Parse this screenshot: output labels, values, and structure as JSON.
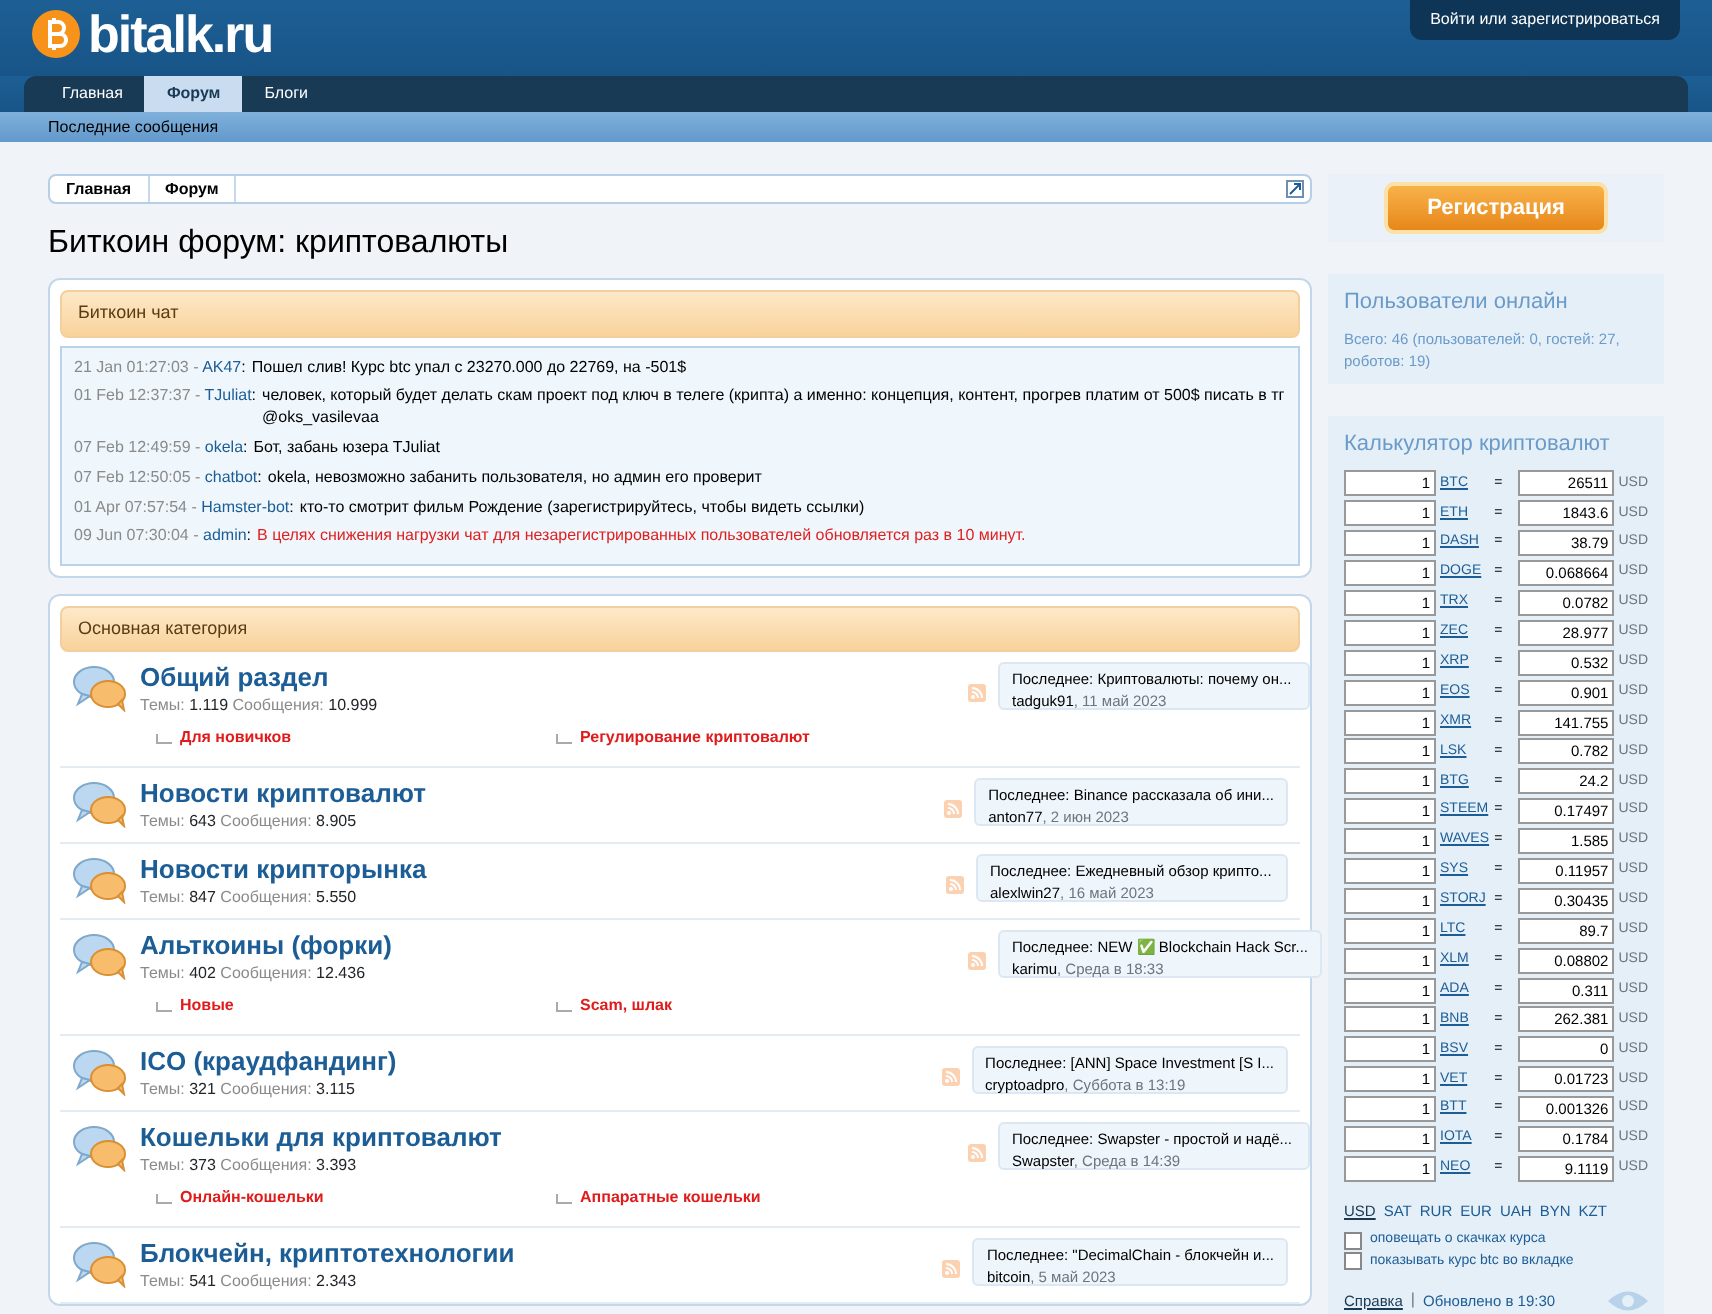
{
  "header": {
    "logo": "bitalk.ru",
    "login_link": "Войти или зарегистрироваться"
  },
  "tabs": [
    {
      "label": "Главная",
      "selected": false
    },
    {
      "label": "Форум",
      "selected": true
    },
    {
      "label": "Блоги",
      "selected": false
    }
  ],
  "subnav": [
    "Последние сообщения"
  ],
  "breadcrumbs": [
    "Главная",
    "Форум"
  ],
  "page_title": "Биткоин форум: криптовалюты",
  "chat": {
    "title": "Биткоин чат",
    "messages": [
      {
        "time": "21 Jan 01:27:03 -",
        "user": "AK47",
        "colon": ":",
        "text": "Пошел слив! Курс btc упал с 23270.000 до 22769, на -501$",
        "alert": false
      },
      {
        "time": "01 Feb 12:37:37 -",
        "user": "TJuliat",
        "colon": ":",
        "text": "человек, который будет делать скам проект под ключ в телеге (крипта) а именно: концепция, контент, прогрев платим от 500$ писать в тг @oks_vasilevaa",
        "alert": false
      },
      {
        "time": "07 Feb 12:49:59 -",
        "user": "okela",
        "colon": ":",
        "text": "Бот, забань юзера TJuliat",
        "alert": false
      },
      {
        "time": "07 Feb 12:50:05 -",
        "user": "chatbot",
        "colon": ":",
        "text": "okela, невозможно забанить пользователя, но админ его проверит",
        "alert": false
      },
      {
        "time": "01 Apr 07:57:54 -",
        "user": "Hamster-bot",
        "colon": ":",
        "text": "кто-то смотрит фильм Рождение (зарегистрируйтесь, чтобы видеть ссылки)",
        "alert": false
      },
      {
        "time": "09 Jun 07:30:04 -",
        "user": "admin",
        "colon": ":",
        "text": "В целях снижения нагрузки чат для незарегистрированных пользователей обновляется раз в 10 минут.",
        "alert": true
      }
    ]
  },
  "category": {
    "title": "Основная категория",
    "forums": [
      {
        "name": "Общий раздел",
        "themes_label": "Темы:",
        "themes": "1.119",
        "posts_label": "Сообщения:",
        "posts": "10.999",
        "subforums": [
          "Для новичков",
          "Регулирование криптовалют"
        ],
        "last_label": "Последнее:",
        "last_title": "Криптовалюты: почему он...",
        "last_user": "tadguk91",
        "last_date": ", 11 май 2023"
      },
      {
        "name": "Новости криптовалют",
        "themes_label": "Темы:",
        "themes": "643",
        "posts_label": "Сообщения:",
        "posts": "8.905",
        "last_label": "Последнее:",
        "last_title": "Binance рассказала об ини...",
        "last_user": "anton77",
        "last_date": ", 2 июн 2023"
      },
      {
        "name": "Новости крипторынка",
        "themes_label": "Темы:",
        "themes": "847",
        "posts_label": "Сообщения:",
        "posts": "5.550",
        "last_label": "Последнее:",
        "last_title": "Ежедневный обзор крипто...",
        "last_user": "alexlwin27",
        "last_date": ", 16 май 2023"
      },
      {
        "name": "Альткоины (форки)",
        "themes_label": "Темы:",
        "themes": "402",
        "posts_label": "Сообщения:",
        "posts": "12.436",
        "subforums": [
          "Новые",
          "Scam, шлак"
        ],
        "last_label": "Последнее:",
        "last_title": "NEW ✅ Blockchain Hack Scr...",
        "last_user": "karimu",
        "last_date": ", Среда в 18:33"
      },
      {
        "name": "ICO (краудфандинг)",
        "themes_label": "Темы:",
        "themes": "321",
        "posts_label": "Сообщения:",
        "posts": "3.115",
        "last_label": "Последнее:",
        "last_title": "[ANN] Space Investment [S I...",
        "last_user": "cryptoadpro",
        "last_date": ", Суббота в 13:19"
      },
      {
        "name": "Кошельки для криптовалют",
        "themes_label": "Темы:",
        "themes": "373",
        "posts_label": "Сообщения:",
        "posts": "3.393",
        "subforums": [
          "Онлайн-кошельки",
          "Аппаратные кошельки"
        ],
        "last_label": "Последнее:",
        "last_title": "Swapster - простой и надё...",
        "last_user": "Swapster",
        "last_date": ", Среда в 14:39"
      },
      {
        "name": "Блокчейн, криптотехнологии",
        "themes_label": "Темы:",
        "themes": "541",
        "posts_label": "Сообщения:",
        "posts": "2.343",
        "last_label": "Последнее:",
        "last_title": "\"DecimalChain - блокчейн и...",
        "last_user": "bitcoin",
        "last_date": ", 5 май 2023"
      }
    ]
  },
  "register_button": "Регистрация",
  "online": {
    "title": "Пользователи онлайн",
    "text": "Всего: 46 (пользователей: 0, гостей: 27, роботов: 19)"
  },
  "calculator": {
    "title": "Калькулятор криптовалют",
    "rows": [
      {
        "amount": "1",
        "coin": "BTC",
        "eq": "=",
        "value": "26511",
        "unit": "USD"
      },
      {
        "amount": "1",
        "coin": "ETH",
        "eq": "=",
        "value": "1843.6",
        "unit": "USD"
      },
      {
        "amount": "1",
        "coin": "DASH",
        "eq": "=",
        "value": "38.79",
        "unit": "USD"
      },
      {
        "amount": "1",
        "coin": "DOGE",
        "eq": "=",
        "value": "0.068664",
        "unit": "USD"
      },
      {
        "amount": "1",
        "coin": "TRX",
        "eq": "=",
        "value": "0.0782",
        "unit": "USD"
      },
      {
        "amount": "1",
        "coin": "ZEC",
        "eq": "=",
        "value": "28.977",
        "unit": "USD"
      },
      {
        "amount": "1",
        "coin": "XRP",
        "eq": "=",
        "value": "0.532",
        "unit": "USD"
      },
      {
        "amount": "1",
        "coin": "EOS",
        "eq": "=",
        "value": "0.901",
        "unit": "USD"
      },
      {
        "amount": "1",
        "coin": "XMR",
        "eq": "=",
        "value": "141.755",
        "unit": "USD"
      },
      {
        "amount": "1",
        "coin": "LSK",
        "eq": "=",
        "value": "0.782",
        "unit": "USD"
      },
      {
        "amount": "1",
        "coin": "BTG",
        "eq": "=",
        "value": "24.2",
        "unit": "USD"
      },
      {
        "amount": "1",
        "coin": "STEEM",
        "eq": "=",
        "value": "0.17497",
        "unit": "USD"
      },
      {
        "amount": "1",
        "coin": "WAVES",
        "eq": "=",
        "value": "1.585",
        "unit": "USD"
      },
      {
        "amount": "1",
        "coin": "SYS",
        "eq": "=",
        "value": "0.11957",
        "unit": "USD"
      },
      {
        "amount": "1",
        "coin": "STORJ",
        "eq": "=",
        "value": "0.30435",
        "unit": "USD"
      },
      {
        "amount": "1",
        "coin": "LTC",
        "eq": "=",
        "value": "89.7",
        "unit": "USD"
      },
      {
        "amount": "1",
        "coin": "XLM",
        "eq": "=",
        "value": "0.08802",
        "unit": "USD"
      },
      {
        "amount": "1",
        "coin": "ADA",
        "eq": "=",
        "value": "0.311",
        "unit": "USD"
      },
      {
        "amount": "1",
        "coin": "BNB",
        "eq": "=",
        "value": "262.381",
        "unit": "USD"
      },
      {
        "amount": "1",
        "coin": "BSV",
        "eq": "=",
        "value": "0",
        "unit": "USD"
      },
      {
        "amount": "1",
        "coin": "VET",
        "eq": "=",
        "value": "0.01723",
        "unit": "USD"
      },
      {
        "amount": "1",
        "coin": "BTT",
        "eq": "=",
        "value": "0.001326",
        "unit": "USD"
      },
      {
        "amount": "1",
        "coin": "IOTA",
        "eq": "=",
        "value": "0.1784",
        "unit": "USD"
      },
      {
        "amount": "1",
        "coin": "NEO",
        "eq": "=",
        "value": "9.1119",
        "unit": "USD"
      }
    ],
    "currencies": [
      {
        "label": "USD",
        "selected": true
      },
      {
        "label": "SAT",
        "selected": false
      },
      {
        "label": "RUR",
        "selected": false
      },
      {
        "label": "EUR",
        "selected": false
      },
      {
        "label": "UAH",
        "selected": false
      },
      {
        "label": "BYN",
        "selected": false
      },
      {
        "label": "KZT",
        "selected": false
      }
    ],
    "options": [
      {
        "label": "оповещать о скачках курса",
        "checked": false
      },
      {
        "label": "показывать курс btc во вкладке",
        "checked": false
      }
    ],
    "help_link": "Справка",
    "separator": "|",
    "updated": "Обновлено в 19:30"
  }
}
